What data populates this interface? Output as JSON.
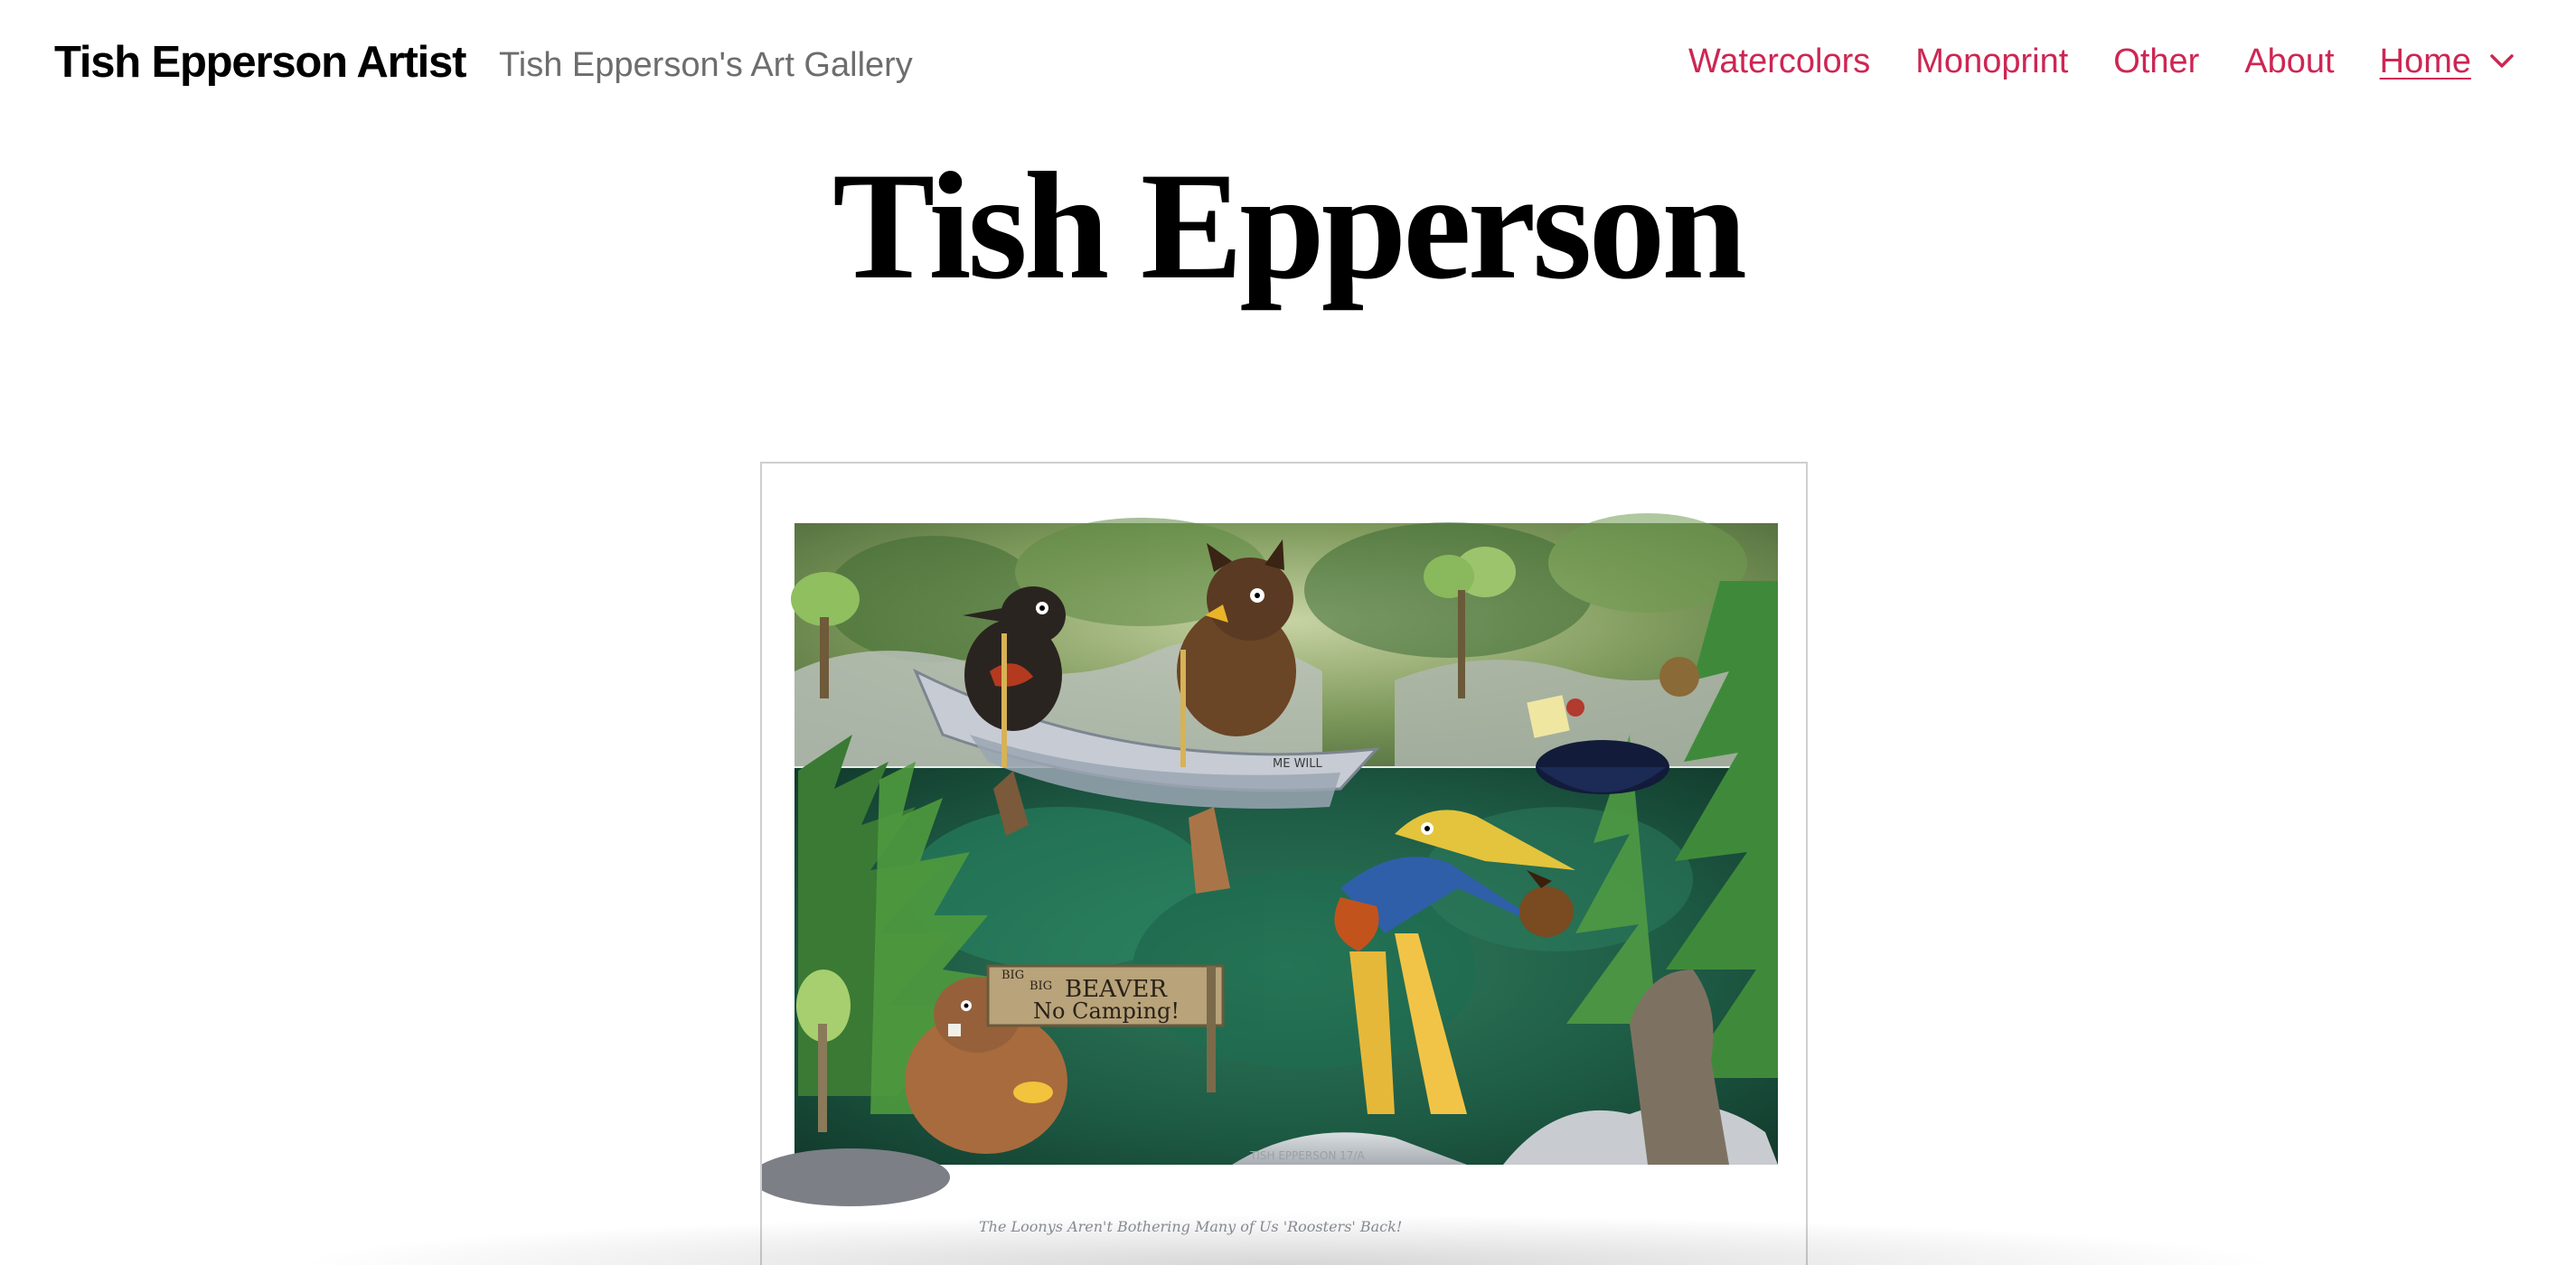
{
  "header": {
    "site_title": "Tish Epperson Artist",
    "site_description": "Tish Epperson's Art Gallery"
  },
  "nav": {
    "items": [
      {
        "label": "Watercolors"
      },
      {
        "label": "Monoprint"
      },
      {
        "label": "Other"
      },
      {
        "label": "About"
      },
      {
        "label": "Home"
      }
    ],
    "current": "Home",
    "dropdown_icon": "chevron-down-icon"
  },
  "page": {
    "title": "Tish Epperson"
  },
  "artwork": {
    "sign_lines": [
      "BIG",
      "BIG",
      "BEAVER",
      "No Camping!"
    ],
    "canoe_text": "ME WILL",
    "signature": "TISH EPPERSON 17/A",
    "caption": "The Loonys Aren't Bothering Many of Us 'Roosters' Back!"
  },
  "colors": {
    "accent": "#cd2653",
    "text": "#000000",
    "muted": "#6d6d6d",
    "background": "#ffffff"
  }
}
